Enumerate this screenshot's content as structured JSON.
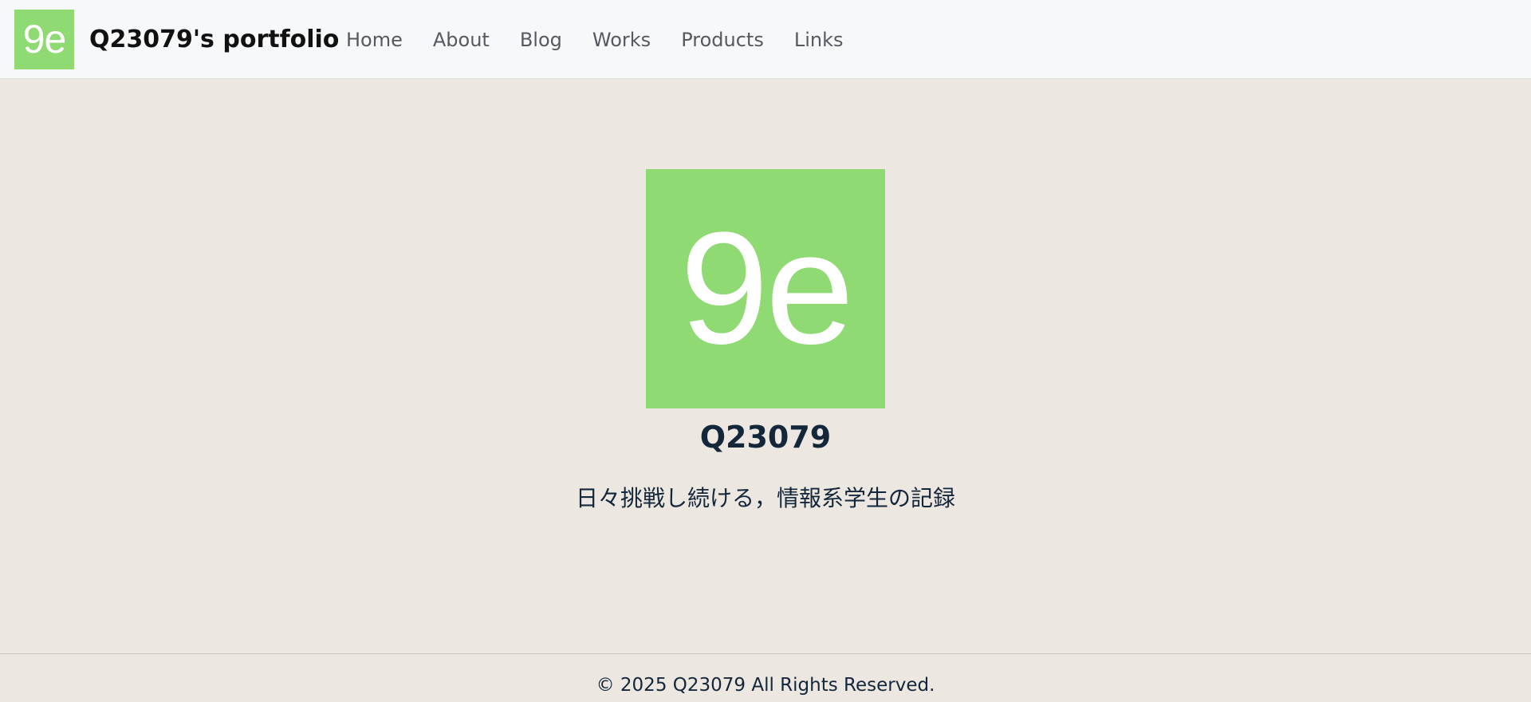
{
  "header": {
    "logo_text": "9e",
    "brand_name": "Q23079's portfolio",
    "nav": [
      {
        "label": "Home"
      },
      {
        "label": "About"
      },
      {
        "label": "Blog"
      },
      {
        "label": "Works"
      },
      {
        "label": "Products"
      },
      {
        "label": "Links"
      }
    ]
  },
  "hero": {
    "logo_text": "9e",
    "name": "Q23079",
    "tagline": "日々挑戦し続ける，情報系学生の記録"
  },
  "footer": {
    "copyright": "© 2025 Q23079 All Rights Reserved."
  },
  "colors": {
    "accent": "#8fda73",
    "background": "#ece7e1",
    "navbar": "#f6f8fa",
    "text": "#13263a"
  }
}
